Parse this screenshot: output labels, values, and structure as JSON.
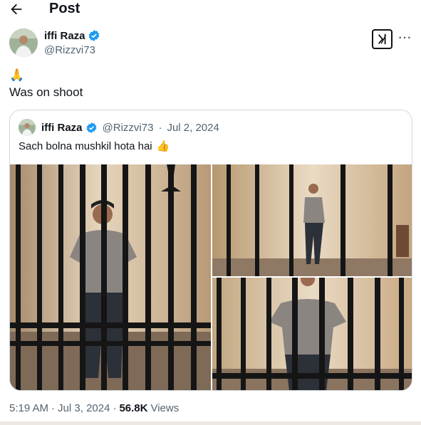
{
  "header": {
    "title": "Post",
    "back_icon": "arrow-left-icon"
  },
  "author": {
    "name": "iffi Raza",
    "handle": "@Rizzvi73",
    "verified_icon": "verified-badge-icon",
    "verified_color": "#1d9bf0"
  },
  "actions": {
    "grok_icon": "grok-icon",
    "more_icon": "more-icon",
    "more_label": "···"
  },
  "post": {
    "emoji": "🙏",
    "text": "Was on shoot"
  },
  "quote": {
    "name": "iffi Raza",
    "handle": "@Rizzvi73",
    "separator": "·",
    "date": "Jul 2, 2024",
    "text": "Sach bolna mushkil hota hai",
    "emoji": "👍",
    "media": [
      {
        "alt": "man standing behind jail bars, hands on hips"
      },
      {
        "alt": "man standing in jail cell seen through bars"
      },
      {
        "alt": "man behind jail bars, close view"
      }
    ]
  },
  "footer": {
    "time": "5:19 AM",
    "separator": "·",
    "date": "Jul 3, 2024",
    "separator2": "·",
    "views_count": "56.8K",
    "views_label": "Views"
  }
}
